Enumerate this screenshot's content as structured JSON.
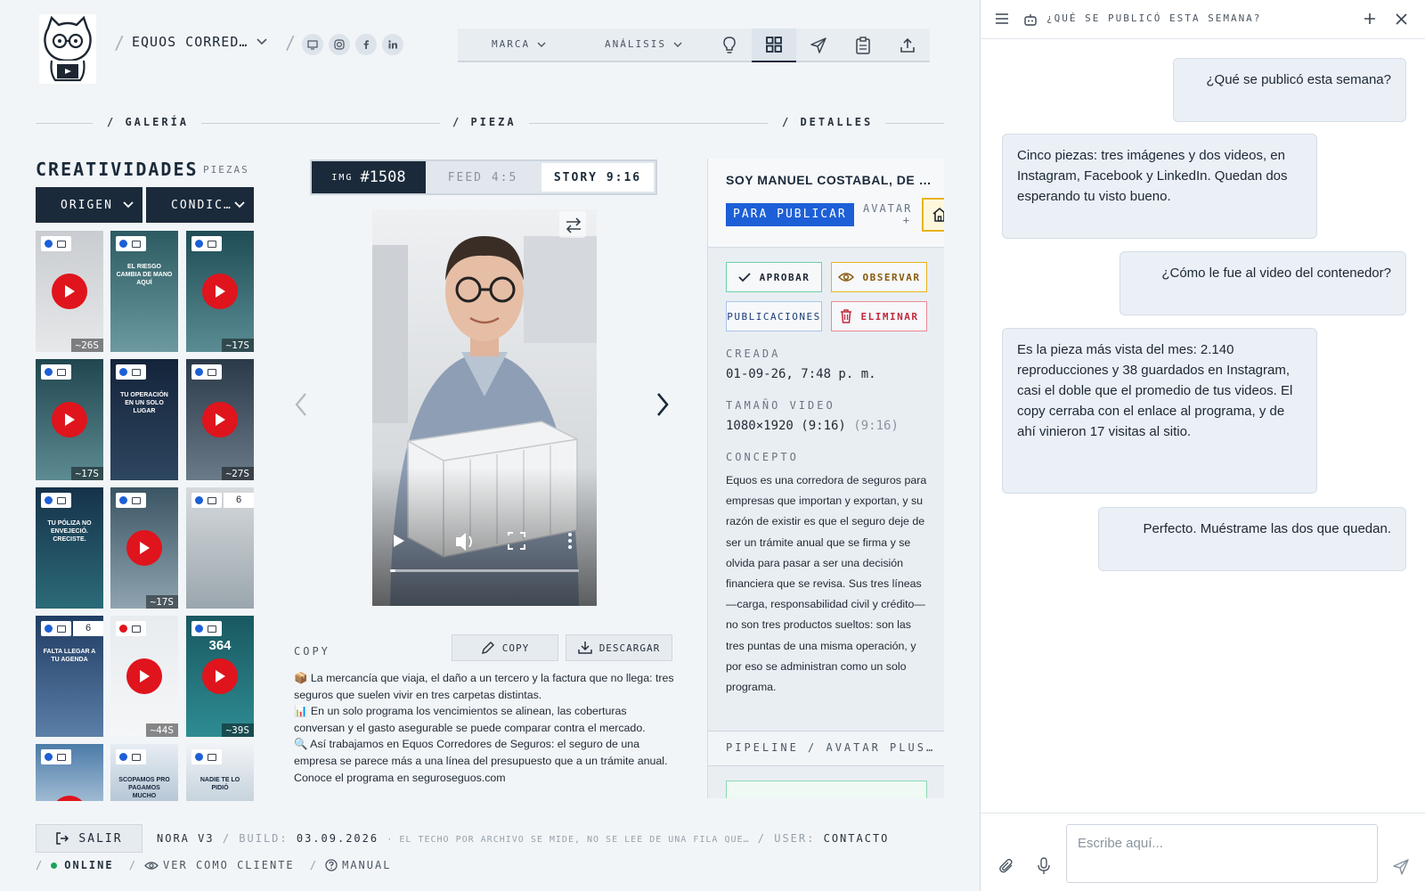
{
  "header": {
    "brand_selector": "EQUOS CORRED…",
    "nav": {
      "marca": "MARCA",
      "analisis": "ANÁLISIS"
    }
  },
  "sections": {
    "galeria": "/ GALERÍA",
    "pieza": "/ PIEZA",
    "detalles": "/ DETALLES"
  },
  "gallery": {
    "title": "CREATIVIDADES",
    "subtitle": "PIEZAS",
    "filters": [
      "ORIGEN",
      "CONDIC…"
    ],
    "thumbs": [
      {
        "type": "video",
        "duration": "~26S"
      },
      {
        "type": "image",
        "text": "EL RIESGO CAMBIA DE MANO AQUÍ"
      },
      {
        "type": "video",
        "duration": "~17S"
      },
      {
        "type": "video",
        "duration": "~17S"
      },
      {
        "type": "image",
        "text": "TU OPERACIÓN EN UN SOLO LUGAR"
      },
      {
        "type": "video",
        "duration": "~27S"
      },
      {
        "type": "image",
        "text": "TU PÓLIZA NO ENVEJECIÓ. CRECISTE."
      },
      {
        "type": "video",
        "duration": "~17S"
      },
      {
        "type": "carousel",
        "count": "6"
      },
      {
        "type": "carousel",
        "count": "6",
        "text": "FALTA LLEGAR A TU AGENDA"
      },
      {
        "type": "video",
        "duration": "~44S"
      },
      {
        "type": "video",
        "duration": "~39S",
        "text": "364"
      },
      {
        "type": "video"
      },
      {
        "type": "image",
        "text": "SCOPAMOS PRO PAGAMOS MUCHO"
      },
      {
        "type": "image",
        "text": "NADIE TE LO PIDIÓ"
      }
    ]
  },
  "piece": {
    "tab_img": "IMG",
    "tab_id": "#1508",
    "tab_feed": "FEED 4:5",
    "tab_story": "STORY 9:16",
    "copy_label": "COPY",
    "copy_button": "COPY",
    "download_button": "DESCARGAR",
    "copy_lines": [
      "📦 La mercancía que viaja, el daño a un tercero y la factura que no llega: tres seguros que suelen vivir en tres carpetas distintas.",
      "📊 En un solo programa los vencimientos se alinean, las coberturas conversan y el gasto asegurable se puede comparar contra el mercado.",
      "🔍 Así trabajamos en Equos Corredores de Seguros: el seguro de una empresa se parece más a una línea del presupuesto que a un trámite anual.",
      "Conoce el programa en seguroseguos.com"
    ]
  },
  "details": {
    "title": "SOY MANUEL COSTABAL, DE E…",
    "badge": "PARA PUBLICAR",
    "avatar_label": "AVATAR +",
    "actions": {
      "aprobar": "APROBAR",
      "observar": "OBSERVAR",
      "publicaciones": "PUBLICACIONES",
      "eliminar": "ELIMINAR"
    },
    "created_label": "CREADA",
    "created_value": "01-09-26, 7:48 p. m.",
    "size_label": "TAMAÑO VIDEO",
    "size_value": "1080×1920 (9:16)",
    "size_ratio": "(9:16)",
    "concept_label": "CONCEPTO",
    "concept_text": "Equos es una corredora de seguros para empresas que importan y exportan, y su razón de existir es que el seguro deje de ser un trámite anual que se firma y se olvida para pasar a ser una decisión financiera que se revisa. Sus tres líneas —carga, responsabilidad civil y crédito— no son tres productos sueltos: son las tres puntas de una misma operación, y por eso se administran como un solo programa.",
    "pipeline": "PIPELINE / AVATAR PLUS…"
  },
  "footer": {
    "salir": "SALIR",
    "version": "NORA V3",
    "build_label": "BUILD:",
    "build_value": "03.09.2026",
    "note": "· EL TECHO POR ARCHIVO SE MIDE, NO SE LEE DE UNA FILA QUE…",
    "user_label": "USER:",
    "user_value": "CONTACTO",
    "status": "ONLINE",
    "client_view": "VER COMO CLIENTE",
    "manual": "MANUAL"
  },
  "chat": {
    "title": "¿QUÉ SE PUBLICÓ ESTA SEMANA?",
    "messages": [
      {
        "role": "user",
        "text": "¿Qué se publicó esta semana?"
      },
      {
        "role": "assistant",
        "text": "Cinco piezas: tres imágenes y dos videos, en Instagram, Facebook y LinkedIn. Quedan dos esperando tu visto bueno."
      },
      {
        "role": "user",
        "text": "¿Cómo le fue al video del contenedor?"
      },
      {
        "role": "assistant",
        "text": "Es la pieza más vista del mes: 2.140 reproducciones y 38 guardados en Instagram, casi el doble que el promedio de tus videos. El copy cerraba con el enlace al programa, y de ahí vinieron 17 visitas al sitio."
      },
      {
        "role": "user",
        "text": "Perfecto. Muéstrame las dos que quedan."
      }
    ],
    "input_placeholder": "Escribe aquí..."
  },
  "colors": {
    "navy": "#1b2a3a",
    "accent_blue": "#1d5fd6",
    "play_red": "#e0141c",
    "approve": "#3fbf8a",
    "observe": "#e8b41c",
    "delete": "#d9364a",
    "online": "#19a55a"
  }
}
